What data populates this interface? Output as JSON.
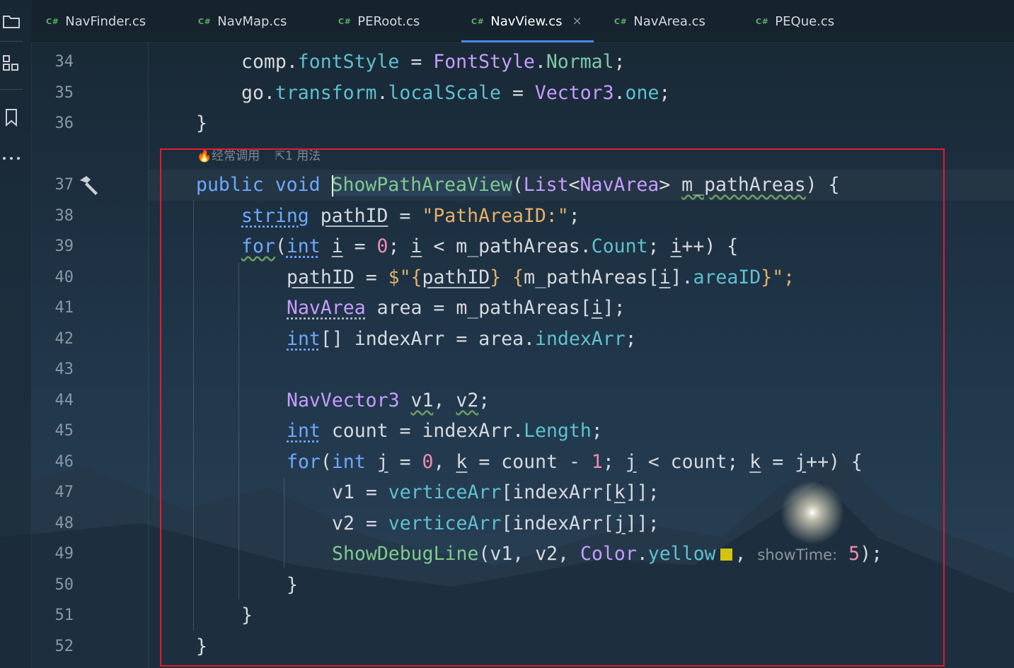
{
  "sidebar": {
    "items": [
      {
        "icon": "folder-icon"
      },
      {
        "icon": "structure-icon"
      },
      {
        "icon": "bookmark-icon"
      },
      {
        "icon": "more-icon"
      }
    ]
  },
  "tabs": [
    {
      "lang": "C#",
      "label": "NavFinder.cs"
    },
    {
      "lang": "C#",
      "label": "NavMap.cs"
    },
    {
      "lang": "C#",
      "label": "PERoot.cs"
    },
    {
      "lang": "C#",
      "label": "NavView.cs",
      "active": true,
      "close": "×"
    },
    {
      "lang": "C#",
      "label": "NavArea.cs"
    },
    {
      "lang": "C#",
      "label": "PEQue.cs"
    }
  ],
  "hints": {
    "usage": "经常调用",
    "count": "1 用法"
  },
  "line_numbers": [
    "34",
    "35",
    "36",
    "37",
    "38",
    "39",
    "40",
    "41",
    "42",
    "43",
    "44",
    "45",
    "46",
    "47",
    "48",
    "49",
    "50",
    "51",
    "52"
  ],
  "code": {
    "l34": [
      "comp",
      ".",
      "fontStyle",
      " = ",
      "FontStyle",
      ".",
      "Normal",
      ";"
    ],
    "l35": [
      "go",
      ".",
      "transform",
      ".",
      "localScale",
      " = ",
      "Vector3",
      ".",
      "one",
      ";"
    ],
    "l36": [
      "}"
    ],
    "l37": [
      "public",
      " ",
      "void",
      " ",
      "ShowPathAreaView",
      "(",
      "List",
      "<",
      "NavArea",
      "> ",
      "m_pathAreas",
      ") {"
    ],
    "l38": [
      "string",
      " ",
      "pathID",
      " = ",
      "\"PathAreaID:\"",
      ";"
    ],
    "l39": [
      "for",
      "(",
      "int",
      " ",
      "i",
      " = ",
      "0",
      "; ",
      "i",
      " < ",
      "m_pathAreas",
      ".",
      "Count",
      "; ",
      "i",
      "++) {"
    ],
    "l40": [
      "pathID",
      " = ",
      "$\"",
      "{",
      "pathID",
      "}",
      " ",
      "{",
      "m_pathAreas[",
      "i",
      "].",
      "areaID",
      "}",
      "\";"
    ],
    "l41": [
      "NavArea",
      " area = m_pathAreas[",
      "i",
      "];"
    ],
    "l42": [
      "int",
      "[] indexArr = area.",
      "indexArr",
      ";"
    ],
    "l44": [
      "NavVector3",
      " ",
      "v1",
      ", ",
      "v2",
      ";"
    ],
    "l45": [
      "int",
      " count = indexArr.",
      "Length",
      ";"
    ],
    "l46": [
      "for",
      "(",
      "int",
      " ",
      "j",
      " = ",
      "0",
      ", ",
      "k",
      " = count - ",
      "1",
      "; ",
      "j",
      " < count; ",
      "k",
      " = ",
      "j",
      "++) {"
    ],
    "l47": [
      "v1 = ",
      "verticeArr",
      "[indexArr[",
      "k",
      "]];"
    ],
    "l48": [
      "v2 = ",
      "verticeArr",
      "[indexArr[",
      "j",
      "]];"
    ],
    "l49": [
      "ShowDebugLine",
      "(v1, v2, ",
      "Color",
      ".",
      "yellow",
      ", ",
      "showTime:",
      " ",
      "5",
      ");"
    ],
    "l50": [
      "}"
    ],
    "l51": [
      "}"
    ],
    "l52": [
      "}"
    ]
  },
  "colors": {
    "keyword": "#6ea8ff",
    "type": "#c79cff",
    "method": "#7ec98f",
    "property": "#5fc0d0",
    "string": "#e5b06a",
    "number": "#f08bb0",
    "highlight_box": "#e8192c",
    "swatch_yellow": "#d4c410"
  }
}
